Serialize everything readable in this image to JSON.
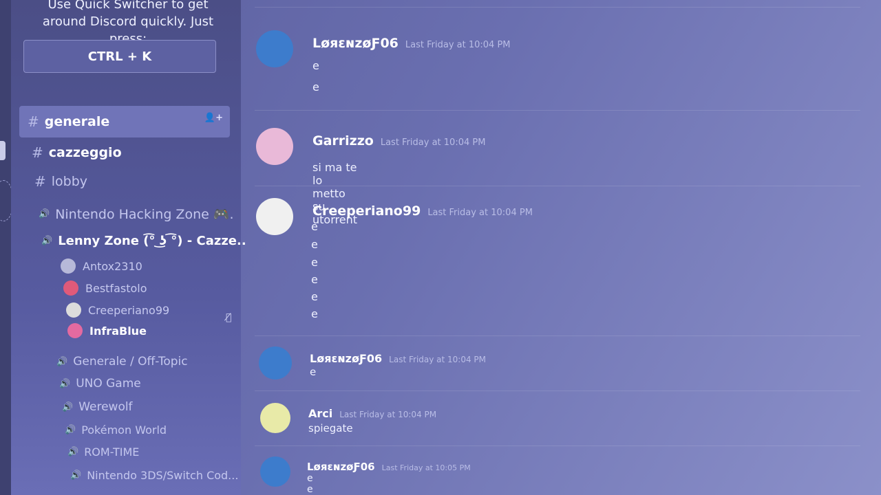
{
  "quick_switcher": {
    "text": "Use Quick Switcher to get around Discord quickly. Just press:",
    "shortcut": "CTRL + K"
  },
  "channels": {
    "text": [
      {
        "name": "generale",
        "active": true
      },
      {
        "name": "cazzeggio",
        "bold": true
      },
      {
        "name": "lobby"
      }
    ],
    "voice": [
      {
        "name": "Nintendo Hacking Zone 🎮."
      },
      {
        "name": "Lenny Zone (͡° ͜ʖ ͡°) - Cazze..",
        "bold": true
      },
      {
        "name": "Generale / Off-Topic"
      },
      {
        "name": "UNO Game"
      },
      {
        "name": "Werewolf"
      },
      {
        "name": "Pokémon World"
      },
      {
        "name": "ROM-TIME"
      },
      {
        "name": "Nintendo 3DS/Switch Cod..."
      }
    ],
    "voice_users": [
      {
        "name": "Antox2310",
        "color": "#b7b9d9"
      },
      {
        "name": "Bestfastolo",
        "color": "#e05a7a"
      },
      {
        "name": "Creeperiano99",
        "color": "#dcdcdc"
      },
      {
        "name": "InfraBlue",
        "color": "#e46aa0"
      }
    ]
  },
  "messages": [
    {
      "author": "LøяɛɴzøƑ06",
      "timestamp": "Last Friday at 10:04 PM",
      "lines": [
        "e",
        "e"
      ],
      "avatar_color": "#3d7ccc"
    },
    {
      "author": "Garrizzo",
      "timestamp": "Last Friday at 10:04 PM",
      "lines": [
        "si ma te lo metto su utorrent"
      ],
      "avatar_color": "#e9b9d8"
    },
    {
      "author": "Creeperiano99",
      "timestamp": "Last Friday at 10:04 PM",
      "lines": [
        "e",
        "e",
        "e",
        "e",
        "e",
        "e"
      ],
      "avatar_color": "#f0f0f0"
    },
    {
      "author": "LøяɛɴzøƑ06",
      "timestamp": "Last Friday at 10:04 PM",
      "lines": [
        "e"
      ],
      "avatar_color": "#3d7ccc"
    },
    {
      "author": "Arci",
      "timestamp": "Last Friday at 10:04 PM",
      "lines": [
        "spiegate"
      ],
      "avatar_color": "#e8eaa8"
    },
    {
      "author": "LøяɛɴzøƑ06",
      "timestamp": "Last Friday at 10:05 PM",
      "lines": [
        "e",
        "e"
      ],
      "avatar_color": "#3d7ccc"
    }
  ]
}
